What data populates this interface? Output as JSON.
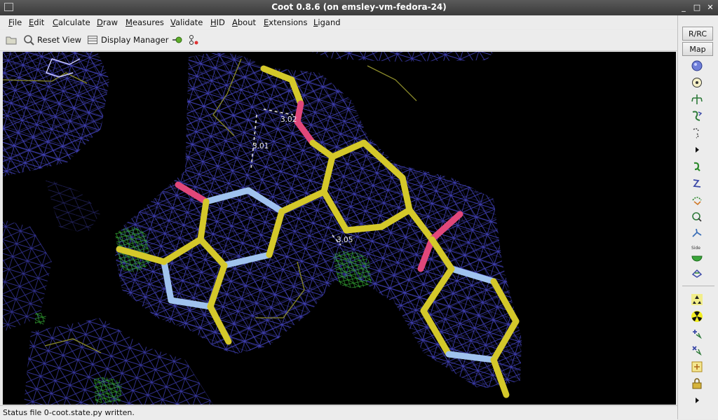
{
  "window": {
    "title": "Coot 0.8.6 (on emsley-vm-fedora-24)",
    "controls": [
      "_",
      "□",
      "✕"
    ]
  },
  "menubar": {
    "items": [
      "File",
      "Edit",
      "Calculate",
      "Draw",
      "Measures",
      "Validate",
      "HID",
      "About",
      "Extensions",
      "Ligand"
    ]
  },
  "toolbar": {
    "reset_view": "Reset View",
    "display_manager": "Display Manager"
  },
  "viewport": {
    "distance_labels": [
      "3.02",
      "3.01",
      "3.05"
    ],
    "colors": {
      "background": "#000000",
      "map_mesh": "#3a3aa8",
      "diff_map_positive": "#2f9a2f",
      "carbon": "#d4c82a",
      "nitrogen": "#9fc2ee",
      "oxygen": "#e0477a",
      "environment_bonds": "#8a8a2a"
    }
  },
  "side_panel": {
    "rrc_label": "R/RC",
    "map_label": "Map",
    "side_label": "Side"
  },
  "status": {
    "text": "Status file 0-coot.state.py written."
  }
}
